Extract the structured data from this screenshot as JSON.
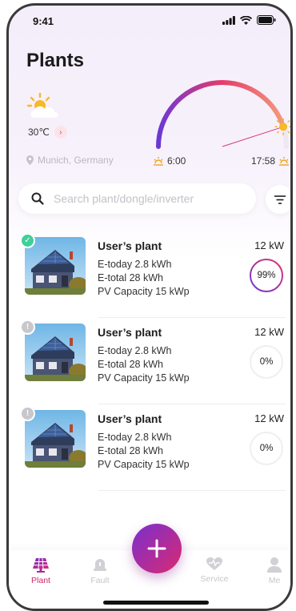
{
  "status_bar": {
    "time": "9:41"
  },
  "page": {
    "title": "Plants"
  },
  "weather": {
    "temperature": "30℃",
    "location": "Munich, Germany",
    "icon": "partly-cloudy-icon"
  },
  "sun": {
    "sunrise": "6:00",
    "sunset": "17:58",
    "day_progress": 0.9
  },
  "search": {
    "placeholder": "Search plant/dongle/inverter",
    "value": ""
  },
  "plants": [
    {
      "name": "User’s plant",
      "e_today": "E-today 2.8 kWh",
      "e_total": "E-total 28 kWh",
      "pv_capacity": "PV Capacity 15 kWp",
      "power": "12 kW",
      "percent_label": "99%",
      "percent": 99,
      "status": "online"
    },
    {
      "name": "User’s plant",
      "e_today": "E-today 2.8 kWh",
      "e_total": "E-total 28 kWh",
      "pv_capacity": "PV Capacity 15 kWp",
      "power": "12 kW",
      "percent_label": "0%",
      "percent": 0,
      "status": "offline"
    },
    {
      "name": "User’s plant",
      "e_today": "E-today 2.8 kWh",
      "e_total": "E-total 28 kWh",
      "pv_capacity": "PV Capacity 15 kWp",
      "power": "12 kW",
      "percent_label": "0%",
      "percent": 0,
      "status": "offline"
    }
  ],
  "tabs": [
    {
      "label": "Plant",
      "icon": "solar-panel-icon",
      "active": true
    },
    {
      "label": "Fault",
      "icon": "alarm-icon",
      "active": false
    },
    {
      "label": "Service",
      "icon": "heart-pulse-icon",
      "active": false
    },
    {
      "label": "Me",
      "icon": "person-icon",
      "active": false
    }
  ],
  "colors": {
    "accent": "#d92a6f",
    "accent_purple": "#7a2fd0",
    "online": "#3fcf9a",
    "offline": "#c7c7cc",
    "sun_yellow": "#f7b928"
  }
}
